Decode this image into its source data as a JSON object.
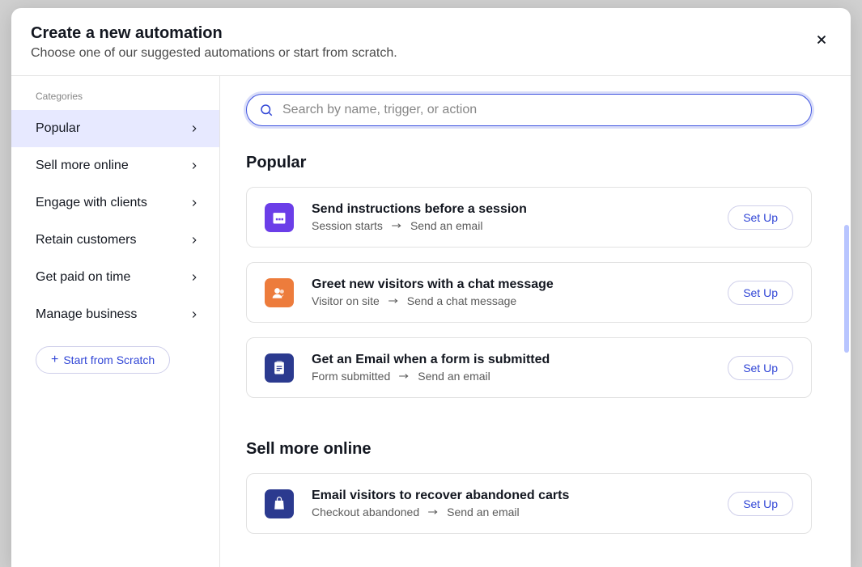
{
  "header": {
    "title": "Create a new automation",
    "subtitle": "Choose one of our suggested automations or start from scratch."
  },
  "sidebar": {
    "heading": "Categories",
    "items": [
      {
        "label": "Popular",
        "active": true
      },
      {
        "label": "Sell more online",
        "active": false
      },
      {
        "label": "Engage with clients",
        "active": false
      },
      {
        "label": "Retain customers",
        "active": false
      },
      {
        "label": "Get paid on time",
        "active": false
      },
      {
        "label": "Manage business",
        "active": false
      }
    ],
    "scratch_label": "Start from Scratch"
  },
  "search": {
    "placeholder": "Search by name, trigger, or action"
  },
  "sections": [
    {
      "title": "Popular",
      "cards": [
        {
          "icon": "calendar",
          "icon_color": "purple",
          "title": "Send instructions before a session",
          "trigger": "Session starts",
          "action": "Send an email",
          "button": "Set Up"
        },
        {
          "icon": "people",
          "icon_color": "orange",
          "title": "Greet new visitors with a chat message",
          "trigger": "Visitor on site",
          "action": "Send a chat message",
          "button": "Set Up"
        },
        {
          "icon": "clipboard",
          "icon_color": "navy",
          "title": "Get an Email when a form is submitted",
          "trigger": "Form submitted",
          "action": "Send an email",
          "button": "Set Up"
        }
      ]
    },
    {
      "title": "Sell more online",
      "cards": [
        {
          "icon": "bag",
          "icon_color": "navy",
          "title": "Email visitors to recover abandoned carts",
          "trigger": "Checkout abandoned",
          "action": "Send an email",
          "button": "Set Up"
        }
      ]
    }
  ]
}
